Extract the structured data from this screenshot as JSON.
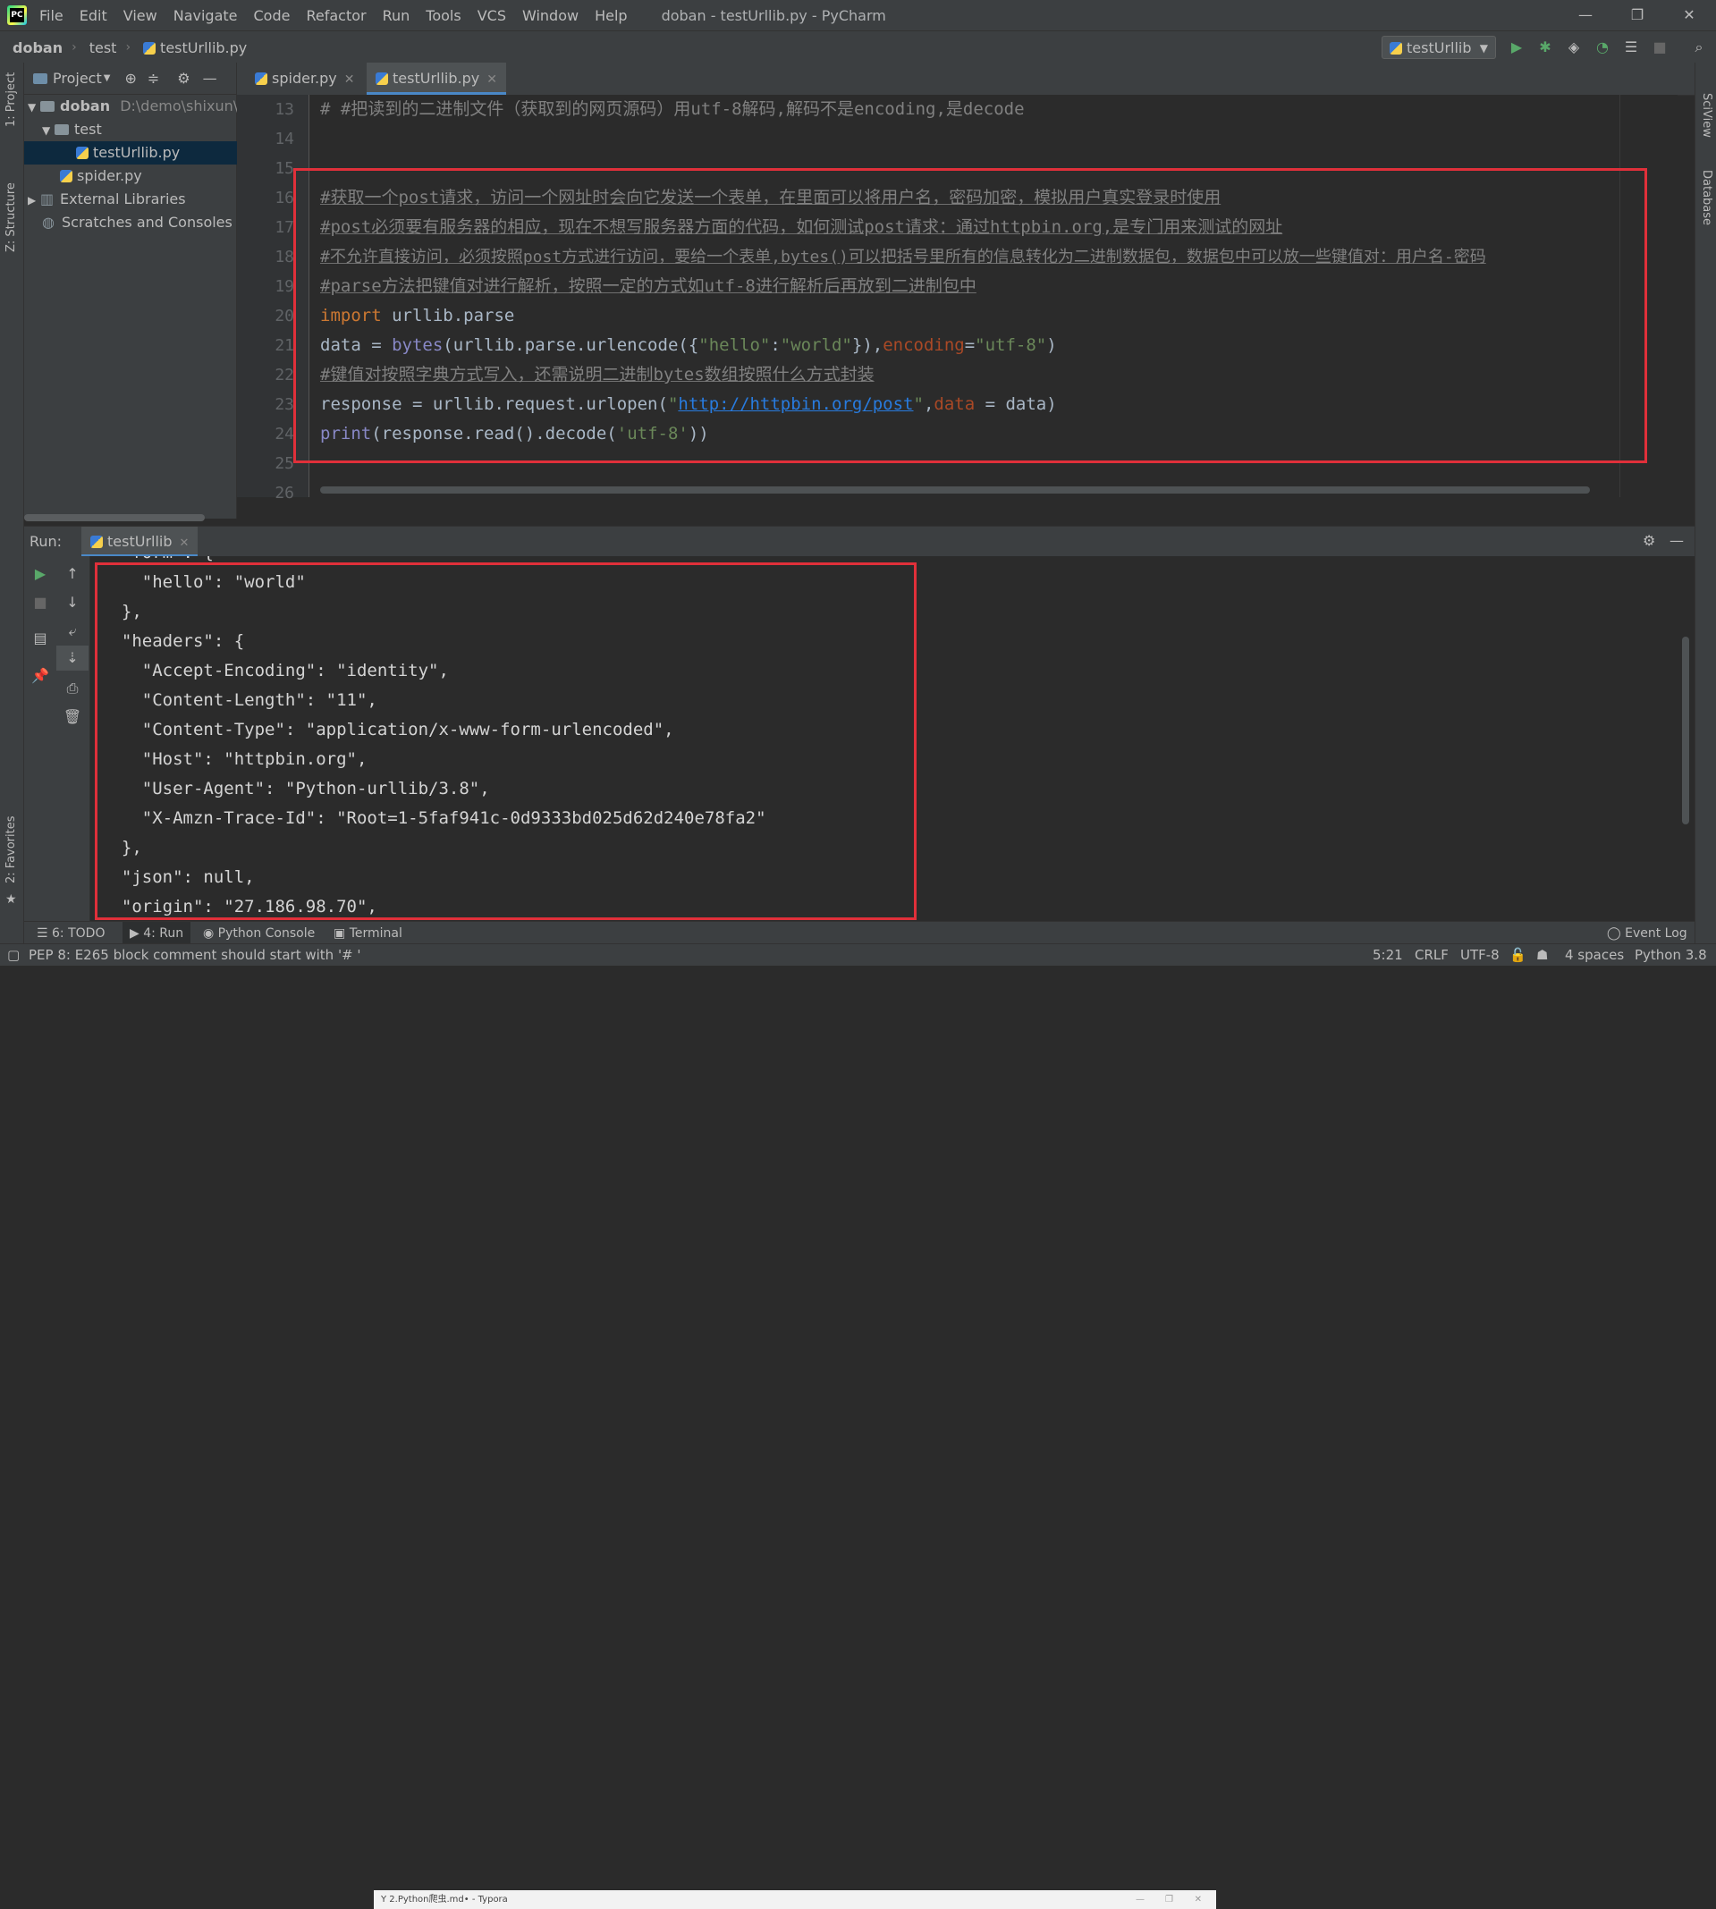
{
  "titlebar": {
    "menu": [
      "File",
      "Edit",
      "View",
      "Navigate",
      "Code",
      "Refactor",
      "Run",
      "Tools",
      "VCS",
      "Window",
      "Help"
    ],
    "window_title": "doban - testUrllib.py - PyCharm",
    "minimize": "—",
    "restore": "❐",
    "close": "✕"
  },
  "navbar": {
    "project": "doban",
    "folder": "test",
    "file": "testUrllib.py",
    "run_config": "testUrllib"
  },
  "sidebar": {
    "project_label": "1: Project",
    "structure_label": "Z: Structure",
    "favorites_label": "2: Favorites",
    "sciview_label": "SciView",
    "database_label": "Database"
  },
  "project_panel": {
    "title": "Project",
    "tree": [
      {
        "label": "doban",
        "path": "D:\\demo\\shixun\\d"
      },
      {
        "label": "test"
      },
      {
        "label": "testUrllib.py"
      },
      {
        "label": "spider.py"
      },
      {
        "label": "External Libraries"
      },
      {
        "label": "Scratches and Consoles"
      }
    ]
  },
  "editor": {
    "tabs": [
      {
        "label": "spider.py"
      },
      {
        "label": "testUrllib.py"
      }
    ],
    "line_numbers": [
      "13",
      "14",
      "15",
      "16",
      "17",
      "18",
      "19",
      "20",
      "21",
      "22",
      "23",
      "24",
      "25",
      "26"
    ],
    "lines": {
      "l13": "# #把读到的二进制文件（获取到的网页源码）用utf-8解码,解码不是encoding,是decode",
      "l16": "#获取一个post请求，访问一个网址时会向它发送一个表单，在里面可以将用户名，密码加密，模拟用户真实登录时使用",
      "l17": "#post必须要有服务器的相应，现在不想写服务器方面的代码，如何测试post请求：通过httpbin.org,是专门用来测试的网址",
      "l18": "#不允许直接访问，必须按照post方式进行访问，要给一个表单,bytes()可以把括号里所有的信息转化为二进制数据包，数据包中可以放一些键值对：用户名-密码",
      "l19": "#parse方法把键值对进行解析，按照一定的方式如utf-8进行解析后再放到二进制包中",
      "l20_kw": "import",
      "l20_rest": " urllib.parse",
      "l21": {
        "a": "data = ",
        "fn": "bytes",
        "b": "(urllib.parse.urlencode({",
        "s1": "\"hello\"",
        "c": ":",
        "s2": "\"world\"",
        "d": "}),",
        "p": "encoding",
        "e": "=",
        "s3": "\"utf-8\"",
        "f": ")"
      },
      "l22": "#键值对按照字典方式写入，还需说明二进制bytes数组按照什么方式封装",
      "l23": {
        "a": "response = urllib.request.urlopen(",
        "q1": "\"",
        "url": "http://httpbin.org/post",
        "q2": "\"",
        "b": ",",
        "p": "data",
        "c": " = data)"
      },
      "l24": {
        "fn": "print",
        "a": "(response.read().decode(",
        "s": "'utf-8'",
        "b": "))"
      }
    }
  },
  "run_panel": {
    "label": "Run:",
    "tab": "testUrllib",
    "output": [
      "  \"form\": {",
      "    \"hello\": \"world\"",
      "  },",
      "  \"headers\": {",
      "    \"Accept-Encoding\": \"identity\",",
      "    \"Content-Length\": \"11\",",
      "    \"Content-Type\": \"application/x-www-form-urlencoded\",",
      "    \"Host\": \"httpbin.org\",",
      "    \"User-Agent\": \"Python-urllib/3.8\",",
      "    \"X-Amzn-Trace-Id\": \"Root=1-5faf941c-0d9333bd025d62d240e78fa2\"",
      "  },",
      "  \"json\": null,",
      "  \"origin\": \"27.186.98.70\","
    ]
  },
  "bottom_tabs": {
    "todo": "6: TODO",
    "run": "4: Run",
    "python_console": "Python Console",
    "terminal": "Terminal",
    "event_log": "Event Log"
  },
  "statusbar": {
    "message": "PEP 8: E265 block comment should start with '# '",
    "position": "5:21",
    "line_sep": "CRLF",
    "encoding": "UTF-8",
    "indent": "4 spaces",
    "interpreter": "Python 3.8",
    "taskbar_item": "Y 2.Python爬虫.md• - Typora"
  },
  "colors": {
    "accent": "#4a88c7",
    "highlight_box": "#e0303a"
  }
}
